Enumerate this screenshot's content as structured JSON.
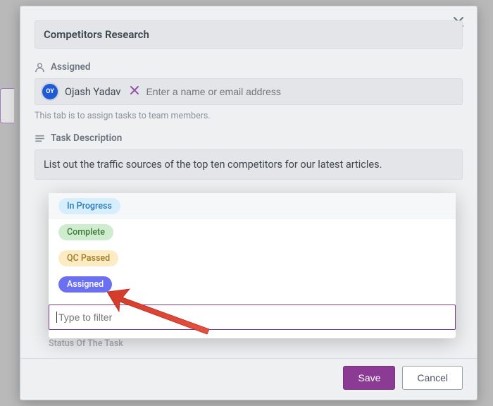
{
  "task": {
    "title": "Competitors Research",
    "description": "List out the traffic sources of the top ten competitors for our latest articles."
  },
  "labels": {
    "assigned": "Assigned",
    "task_description": "Task Description",
    "helper": "This tab is to assign tasks to team members.",
    "status_dimmed": "Status Of The Task"
  },
  "assignee": {
    "initials": "OY",
    "name": "Ojash Yadav",
    "placeholder": "Enter a name or email address"
  },
  "dropdown": {
    "options": [
      {
        "label": "In Progress",
        "style": "ip"
      },
      {
        "label": "Complete",
        "style": "cp"
      },
      {
        "label": "QC Passed",
        "style": "qc"
      },
      {
        "label": "Assigned",
        "style": "as"
      }
    ],
    "filter_placeholder": "Type to filter"
  },
  "footer": {
    "save": "Save",
    "cancel": "Cancel"
  }
}
